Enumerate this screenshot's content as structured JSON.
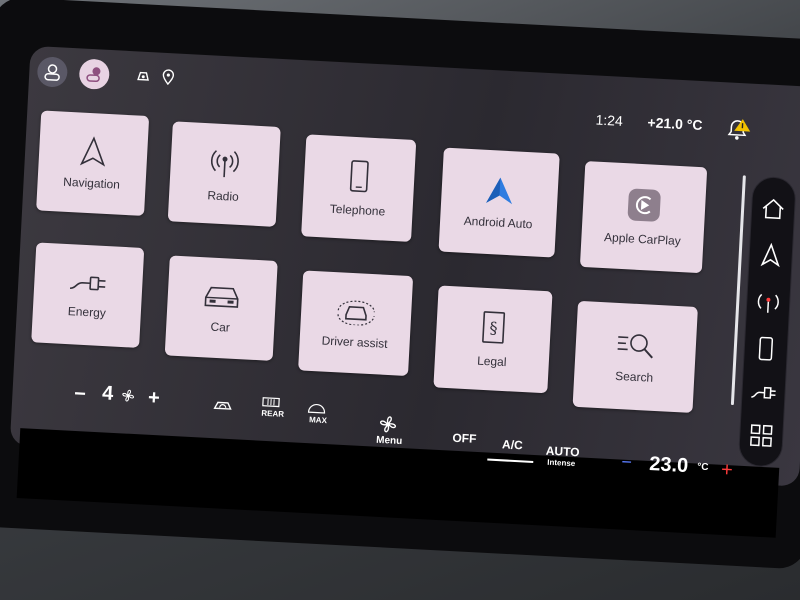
{
  "status": {
    "time": "1:24",
    "temperature": "+21.0 °C"
  },
  "tiles": [
    {
      "label": "Navigation",
      "icon": "navigation-arrow-icon"
    },
    {
      "label": "Radio",
      "icon": "radio-antenna-icon"
    },
    {
      "label": "Telephone",
      "icon": "phone-icon"
    },
    {
      "label": "Android Auto",
      "icon": "android-auto-icon"
    },
    {
      "label": "Apple CarPlay",
      "icon": "carplay-icon"
    },
    {
      "label": "Energy",
      "icon": "plug-icon"
    },
    {
      "label": "Car",
      "icon": "car-icon"
    },
    {
      "label": "Driver assist",
      "icon": "driver-assist-icon"
    },
    {
      "label": "Legal",
      "icon": "legal-section-icon"
    },
    {
      "label": "Search",
      "icon": "search-icon"
    }
  ],
  "rail": [
    "home-icon",
    "navigation-arrow-icon",
    "radio-antenna-icon",
    "phone-icon",
    "plug-icon",
    "apps-grid-icon"
  ],
  "climate": {
    "minus": "−",
    "fan_level": "4",
    "plus": "+",
    "rear_label": "REAR",
    "max_label": "MAX",
    "menu_label": "Menu",
    "off_label": "OFF",
    "ac_label": "A/C",
    "auto_label": "AUTO",
    "intense_label": "Intense",
    "temp_minus": "−",
    "temp_value": "23.0",
    "temp_unit": "°C",
    "temp_plus": "+"
  },
  "colors": {
    "tile_bg": "#ead9e6",
    "accent_blue": "#2f7de1",
    "warning_yellow": "#f2c200",
    "temp_minus_blue": "#5b7cff",
    "temp_plus_red": "#ff3b3b"
  }
}
